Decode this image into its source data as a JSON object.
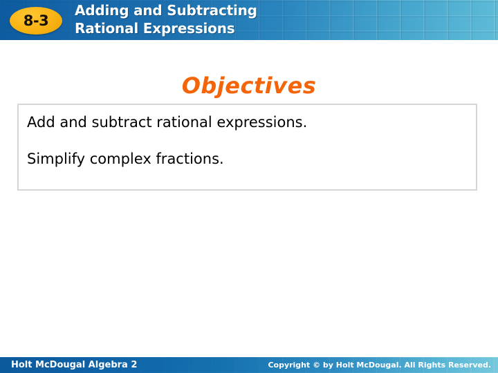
{
  "header": {
    "lesson_number": "8-3",
    "title_line1": "Adding and Subtracting",
    "title_line2": "Rational Expressions",
    "bg_color_left": "#0d5a9e",
    "bg_color_right": "#5fbcd8",
    "badge_color": "#fbb617",
    "title_color": "#ffffff"
  },
  "objectives": {
    "heading": "Objectives",
    "heading_color": "#f4650a",
    "items": [
      "Add and subtract rational expressions.",
      "Simplify complex fractions."
    ],
    "box_border_color": "#d6d6d6",
    "box_background": "#ffffff"
  },
  "footer": {
    "left_text": "Holt McDougal Algebra 2",
    "right_text": "Copyright © by Holt McDougal. All Rights Reserved.",
    "bg_color_left": "#0c5a9c",
    "bg_color_right": "#76c9dd",
    "text_color": "#ffffff"
  }
}
